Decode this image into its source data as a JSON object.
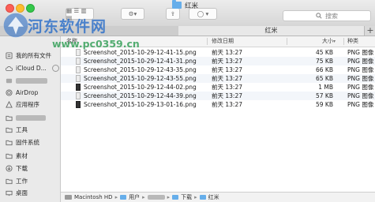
{
  "window": {
    "title": "红米"
  },
  "toolbar": {
    "search_placeholder": "搜索"
  },
  "tab": {
    "label": "红米",
    "close": "×",
    "add": "+"
  },
  "sidebar": {
    "items": [
      {
        "label": "我的所有文件",
        "icon": "all-files-icon"
      },
      {
        "label": "iCloud D...",
        "icon": "cloud-icon"
      },
      {
        "label": "",
        "icon": "device-icon"
      },
      {
        "label": "AirDrop",
        "icon": "airdrop-icon"
      },
      {
        "label": "应用程序",
        "icon": "applications-icon"
      },
      {
        "label": "",
        "icon": "folder-icon"
      },
      {
        "label": "工具",
        "icon": "folder-icon"
      },
      {
        "label": "固件系统",
        "icon": "folder-icon"
      },
      {
        "label": "素材",
        "icon": "folder-icon"
      },
      {
        "label": "下载",
        "icon": "download-icon"
      },
      {
        "label": "工作",
        "icon": "folder-icon"
      },
      {
        "label": "桌面",
        "icon": "desktop-icon"
      }
    ]
  },
  "columns": {
    "name": "名称",
    "date": "修改日期",
    "size": "大小",
    "kind": "种类"
  },
  "files": [
    {
      "name": "Screenshot_2015-10-29-12-41-15.png",
      "date": "前天 13:27",
      "size": "45 KB",
      "kind": "PNG 图像"
    },
    {
      "name": "Screenshot_2015-10-29-12-41-31.png",
      "date": "前天 13:27",
      "size": "75 KB",
      "kind": "PNG 图像"
    },
    {
      "name": "Screenshot_2015-10-29-12-43-35.png",
      "date": "前天 13:27",
      "size": "66 KB",
      "kind": "PNG 图像"
    },
    {
      "name": "Screenshot_2015-10-29-12-43-55.png",
      "date": "前天 13:27",
      "size": "65 KB",
      "kind": "PNG 图像"
    },
    {
      "name": "Screenshot_2015-10-29-12-44-02.png",
      "date": "前天 13:27",
      "size": "1 MB",
      "kind": "PNG 图像"
    },
    {
      "name": "Screenshot_2015-10-29-12-44-39.png",
      "date": "前天 13:27",
      "size": "57 KB",
      "kind": "PNG 图像"
    },
    {
      "name": "Screenshot_2015-10-29-13-01-16.png",
      "date": "前天 13:27",
      "size": "59 KB",
      "kind": "PNG 图像"
    }
  ],
  "pathbar": {
    "segments": [
      "Macintosh HD",
      "用户",
      "",
      "下载",
      "红米"
    ],
    "separator": "▸"
  },
  "watermark": {
    "title": "河东软件网",
    "url": "www.pc0359.cn"
  },
  "colors": {
    "accent_folder": "#66aeea",
    "watermark_blue": "#2369c8",
    "watermark_green": "#1e9646"
  }
}
